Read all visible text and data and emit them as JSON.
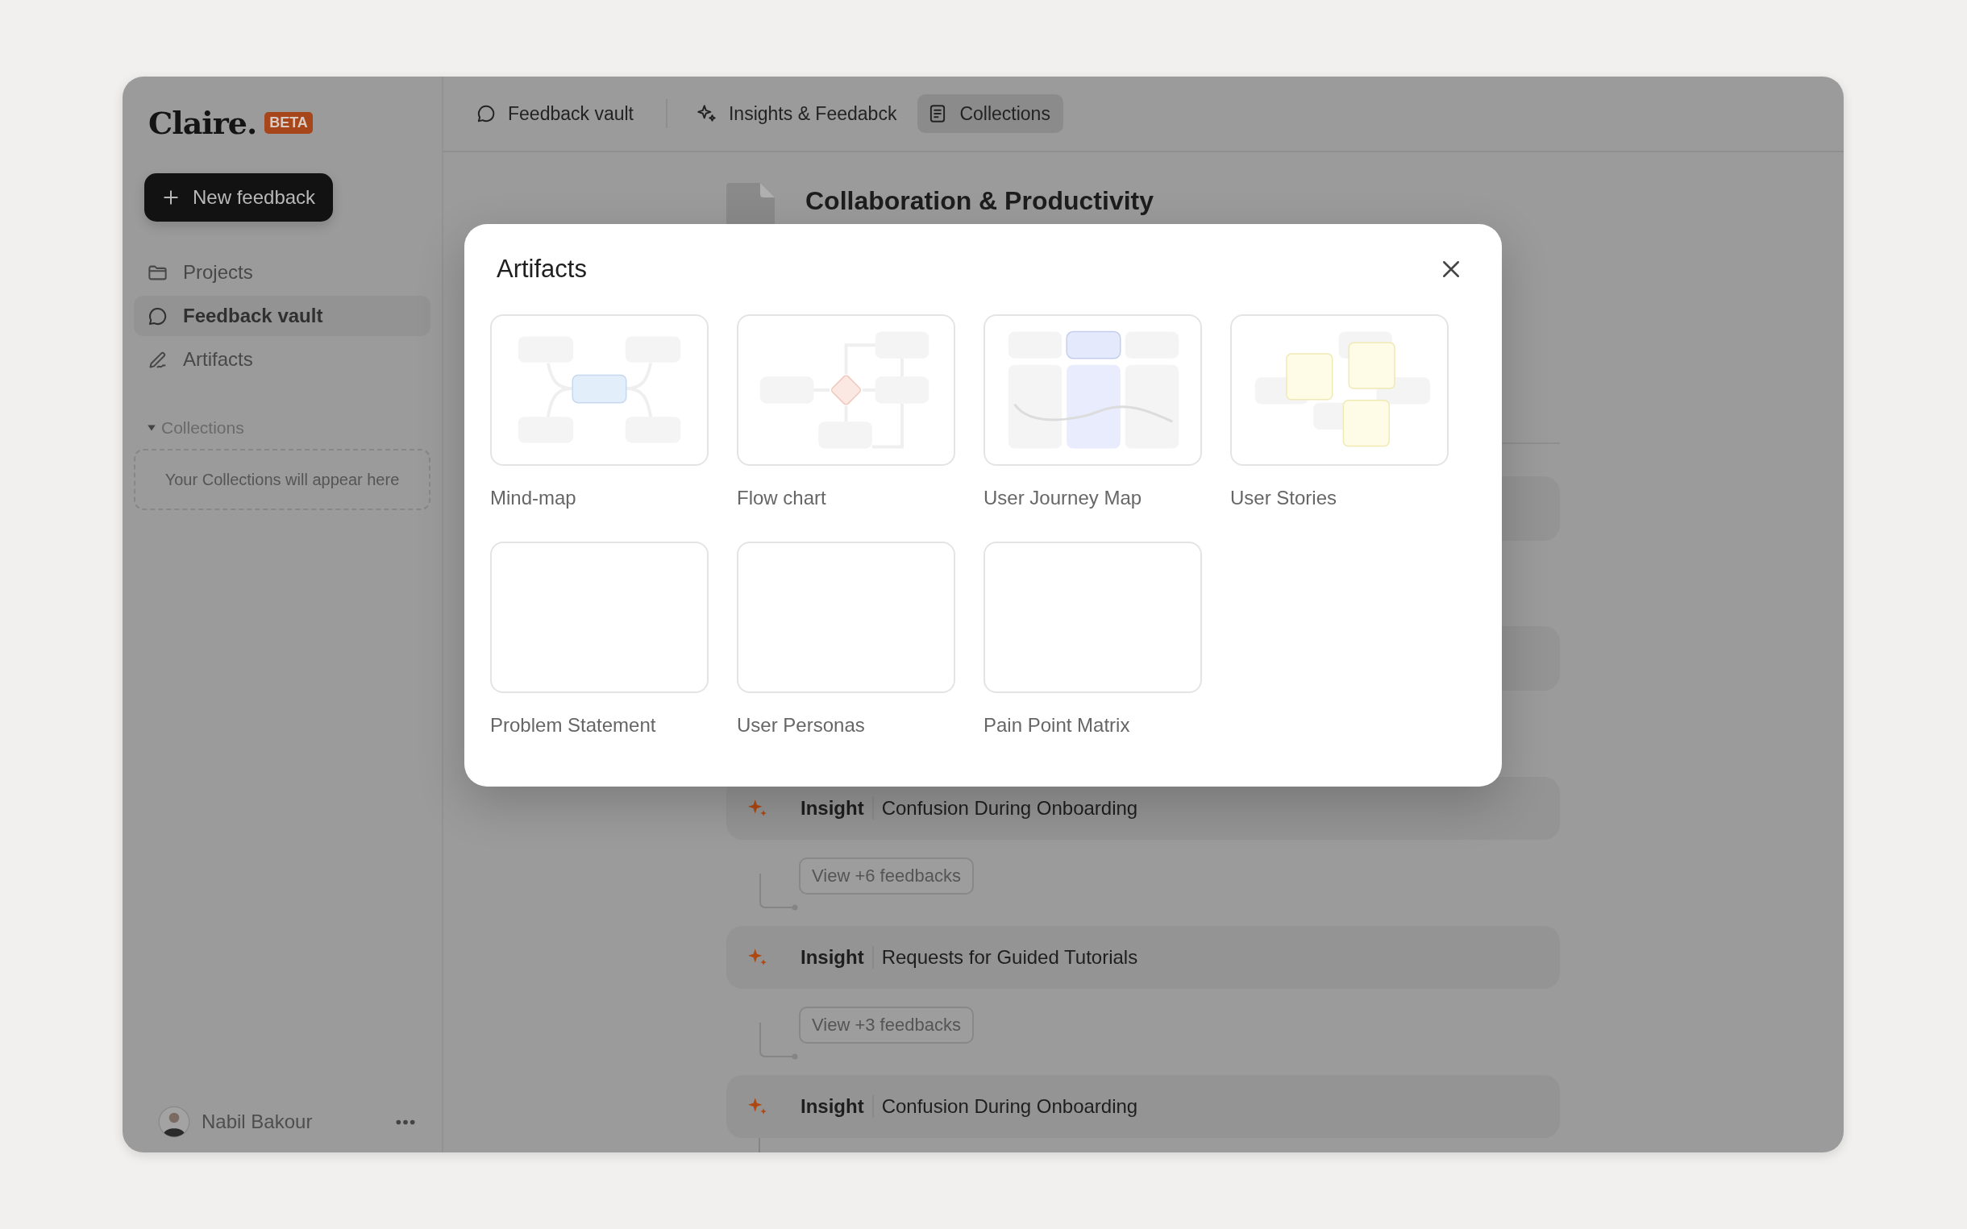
{
  "app": {
    "logo": "Claire.",
    "badge": "BETA"
  },
  "sidebar": {
    "new_button": "New feedback",
    "items": [
      {
        "label": "Projects",
        "selected": false
      },
      {
        "label": "Feedback vault",
        "selected": true
      },
      {
        "label": "Artifacts",
        "selected": false
      }
    ],
    "collections": {
      "label": "Collections",
      "expanded": true,
      "empty_text": "Your Collections will appear here"
    },
    "user": {
      "name": "Nabil Bakour"
    }
  },
  "topbar": {
    "tabs": [
      {
        "label": "Feedback vault",
        "selected": false
      },
      {
        "label": "Insights & Feedabck",
        "selected": false
      },
      {
        "label": "Collections",
        "selected": true
      }
    ]
  },
  "page": {
    "title": "Collaboration & Productivity",
    "insights": [
      {
        "label": "Insight",
        "title": "Confusion During Onboarding",
        "feedbacks": "View +6 feedbacks"
      },
      {
        "label": "Insight",
        "title": "Requests for Guided Tutorials",
        "feedbacks": "View +3 feedbacks"
      },
      {
        "label": "Insight",
        "title": "Confusion During Onboarding"
      }
    ]
  },
  "modal": {
    "title": "Artifacts",
    "items": [
      {
        "label": "Mind-map",
        "kind": "mind-map"
      },
      {
        "label": "Flow chart",
        "kind": "flow-chart"
      },
      {
        "label": "User Journey Map",
        "kind": "journey-map"
      },
      {
        "label": "User Stories",
        "kind": "stories"
      },
      {
        "label": "Problem Statement",
        "kind": "blank"
      },
      {
        "label": "User Personas",
        "kind": "blank"
      },
      {
        "label": "Pain Point Matrix",
        "kind": "blank"
      }
    ]
  }
}
